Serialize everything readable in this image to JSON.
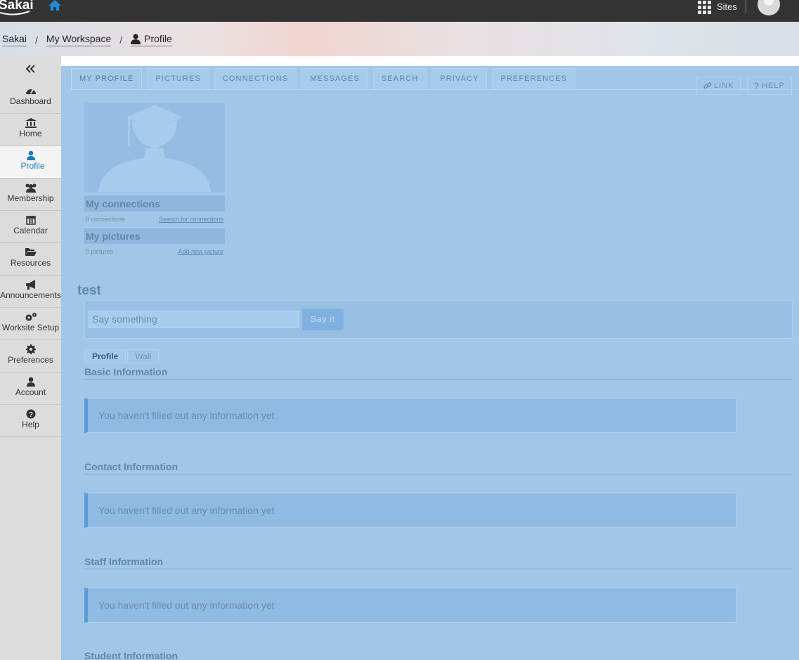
{
  "topbar": {
    "logo_text": "Sakai",
    "sites_label": "Sites"
  },
  "breadcrumb": {
    "items": [
      "Sakai",
      "My Workspace",
      "Profile"
    ]
  },
  "sidebar": {
    "items": [
      {
        "label": "Dashboard",
        "icon": "dashboard-icon"
      },
      {
        "label": "Home",
        "icon": "bank-icon"
      },
      {
        "label": "Profile",
        "icon": "user-icon"
      },
      {
        "label": "Membership",
        "icon": "users-icon"
      },
      {
        "label": "Calendar",
        "icon": "calendar-icon"
      },
      {
        "label": "Resources",
        "icon": "folder-open-icon"
      },
      {
        "label": "Announcements",
        "icon": "bullhorn-icon"
      },
      {
        "label": "Worksite Setup",
        "icon": "gears-icon"
      },
      {
        "label": "Preferences",
        "icon": "gear-icon"
      },
      {
        "label": "Account",
        "icon": "user-icon"
      },
      {
        "label": "Help",
        "icon": "question-circle-icon"
      }
    ],
    "active": "Profile"
  },
  "tool": {
    "tabs": [
      "MY PROFILE",
      "PICTURES",
      "CONNECTIONS",
      "MESSAGES",
      "SEARCH",
      "PRIVACY",
      "PREFERENCES"
    ],
    "link_label": "LINK",
    "help_label": "HELP"
  },
  "side_panel": {
    "connections_title": "My connections",
    "connections_count": "0 connections",
    "connections_link": "Search for connections",
    "pictures_title": "My pictures",
    "pictures_count": "0 pictures",
    "pictures_link": "Add new picture"
  },
  "profile": {
    "name": "test",
    "status_placeholder": "Say something",
    "status_button": "Say it",
    "subtabs": [
      "Profile",
      "Wall"
    ],
    "sections": [
      {
        "title": "Basic Information",
        "notice": "You haven't filled out any information yet"
      },
      {
        "title": "Contact Information",
        "notice": "You haven't filled out any information yet"
      },
      {
        "title": "Staff Information",
        "notice": "You haven't filled out any information yet"
      },
      {
        "title": "Student Information",
        "notice": ""
      }
    ]
  },
  "colors": {
    "topbar": "#333333",
    "overlay_blue": "#a1c6e8",
    "active_nav": "#1a7bb8"
  }
}
